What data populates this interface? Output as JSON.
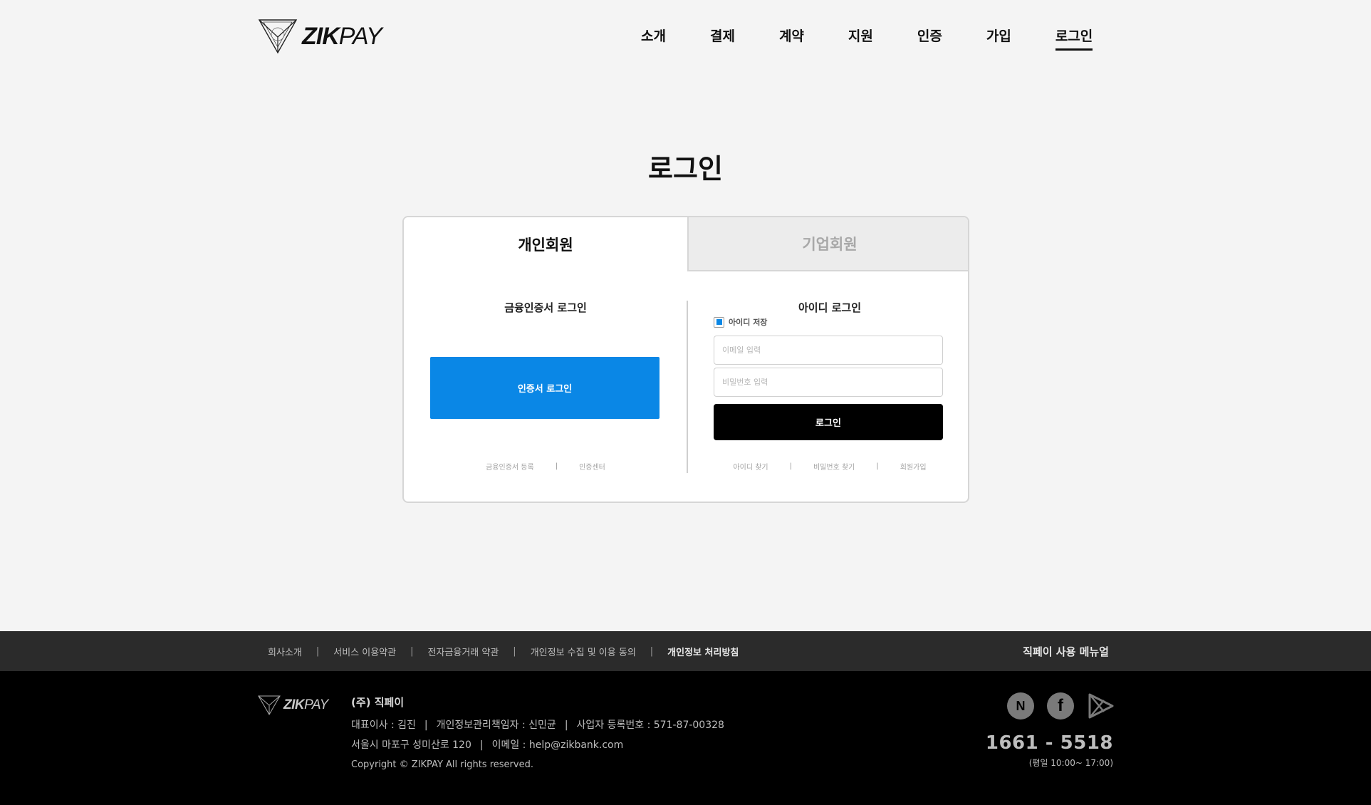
{
  "brand": {
    "logo_bold": "ZIK",
    "logo_regular": "PAY"
  },
  "nav": {
    "items": [
      "소개",
      "결제",
      "계약",
      "지원",
      "인증",
      "가입"
    ],
    "active": "로그인"
  },
  "page": {
    "title": "로그인"
  },
  "tabs": {
    "personal": "개인회원",
    "business": "기업회원"
  },
  "cert_login": {
    "title": "금융인증서 로그인",
    "button": "인증서 로그인",
    "links": [
      "금융인증서 등록",
      "인증센터"
    ]
  },
  "id_login": {
    "title": "아이디 로그인",
    "save_id_label": "아이디 저장",
    "save_id_checked": true,
    "email_placeholder": "이메일 입력",
    "password_placeholder": "비밀번호 입력",
    "button": "로그인",
    "links": [
      "아이디 찾기",
      "비밀번호 찾기",
      "회원가입"
    ]
  },
  "footer_bar": {
    "links": [
      "회사소개",
      "서비스 이용약관",
      "전자금융거래 약관",
      "개인정보 수집 및 이용 동의",
      "개인정보 처리방침"
    ],
    "manual": "직페이 사용 메뉴얼"
  },
  "footer": {
    "company_name": "(주) 직페이",
    "ceo": "대표이사 : 김진",
    "privacy_officer": "개인정보관리책임자 : 신민균",
    "business_no": "사업자 등록번호 : 571-87-00328",
    "address": "서울시 마포구 성미산로 120",
    "email": "이메일 : help@zikbank.com",
    "copyright": "Copyright © ZIKPAY All rights reserved.",
    "social_icons": [
      "naver-icon",
      "facebook-icon",
      "play-store-icon"
    ],
    "phone": "1661 - 5518",
    "hours": "(평일 10:00~ 17:00)"
  },
  "colors": {
    "accent": "#0a87e6",
    "dark": "#000000",
    "footer_bar": "#2b2b2b",
    "background": "#f4f4f4"
  }
}
